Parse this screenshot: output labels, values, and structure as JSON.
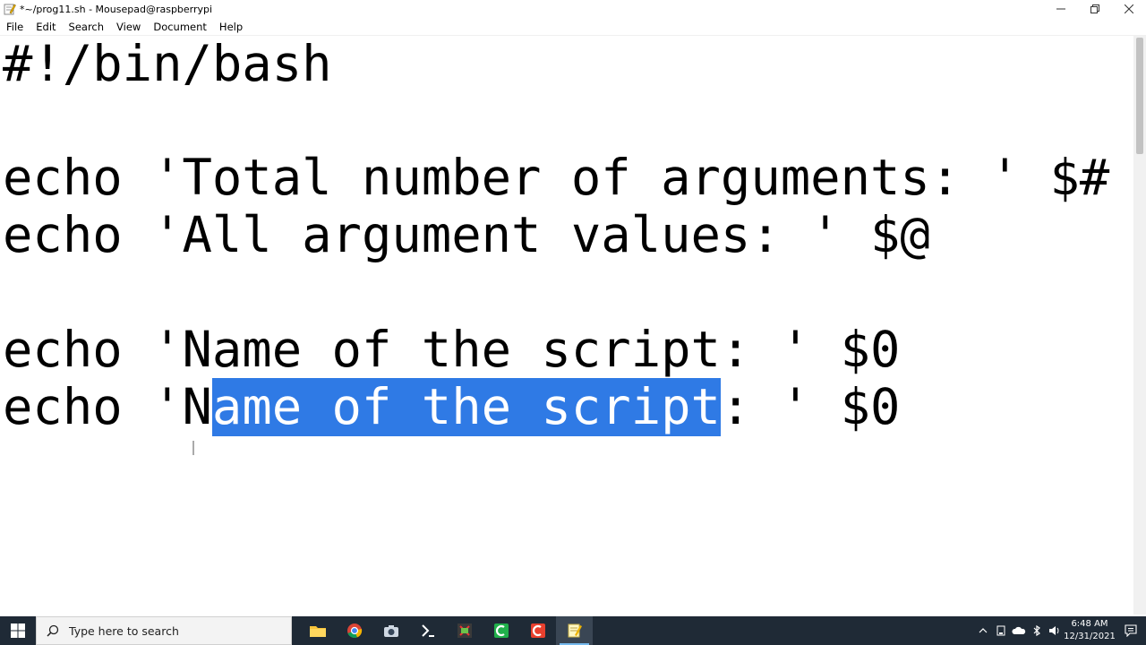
{
  "window": {
    "title": "*~/prog11.sh - Mousepad@raspberrypi"
  },
  "menu": [
    "File",
    "Edit",
    "Search",
    "View",
    "Document",
    "Help"
  ],
  "editor": {
    "lines": [
      {
        "text": "#!/bin/bash"
      },
      {
        "text": ""
      },
      {
        "text": "echo 'Total number of arguments: ' $#"
      },
      {
        "text": "echo 'All argument values: ' $@"
      },
      {
        "text": ""
      },
      {
        "text": "echo 'Name of the script: ' $0"
      },
      {
        "before": "echo 'N",
        "selected": "ame of the script",
        "after": ": ' $0"
      }
    ],
    "selection_color": "#2f7ae5"
  },
  "taskbar": {
    "search_placeholder": "Type here to search",
    "apps": [
      "file-explorer-icon",
      "chrome-icon",
      "camera-icon",
      "powershell-icon",
      "vnc-icon",
      "green-app-icon",
      "red-app-icon",
      "mousepad-icon"
    ],
    "clock": {
      "time": "6:48 AM",
      "date": "12/31/2021"
    }
  }
}
